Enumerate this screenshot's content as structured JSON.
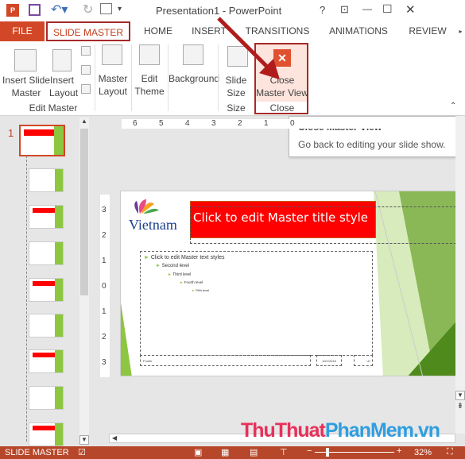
{
  "window": {
    "title": "Presentation1 - PowerPoint",
    "help": "?",
    "ribbon_options": "⊡",
    "minimize": "—",
    "maximize": "☐",
    "close": "✕"
  },
  "tabs": [
    {
      "label": "FILE"
    },
    {
      "label": "SLIDE MASTER"
    },
    {
      "label": "HOME"
    },
    {
      "label": "INSERT"
    },
    {
      "label": "TRANSITIONS"
    },
    {
      "label": "ANIMATIONS"
    },
    {
      "label": "REVIEW"
    }
  ],
  "ribbon": {
    "insert_slide_master": "Insert Slide\nMaster",
    "insert_layout": "Insert\nLayout",
    "edit_master_group": "Edit Master",
    "master_layout": "Master\nLayout",
    "edit_theme": "Edit\nTheme",
    "background": "Background",
    "slide_size": "Slide\nSize",
    "size_group": "Size",
    "close_master_view": "Close\nMaster View",
    "close_group": "Close"
  },
  "tooltip": {
    "title": "Close Master View",
    "description": "Go back to editing your slide show."
  },
  "thumbnails": {
    "selected_number": "1",
    "count": 9
  },
  "ruler": {
    "h": [
      "6",
      "5",
      "4",
      "3",
      "2",
      "1",
      "0"
    ],
    "v": [
      "3",
      "2",
      "1",
      "0",
      "1",
      "2",
      "3"
    ]
  },
  "slide": {
    "title": "Click to edit Master title style",
    "logo_text": "Vietnam",
    "levels": [
      "Click to edit Master text styles",
      "Second level",
      "Third level",
      "Fourth level",
      "Fifth level"
    ],
    "footer": "Footer",
    "date": "10/1/2016",
    "number": "‹#›"
  },
  "watermark": {
    "part1": "ThuThuat",
    "part2": "PhanMem",
    "part3": ".vn"
  },
  "status": {
    "mode": "SLIDE MASTER",
    "zoom": "32%"
  },
  "colors": {
    "accent": "#b7472a",
    "title_fill": "#ff0000",
    "green": "#8dc63f",
    "arrow": "#b01c1c"
  }
}
